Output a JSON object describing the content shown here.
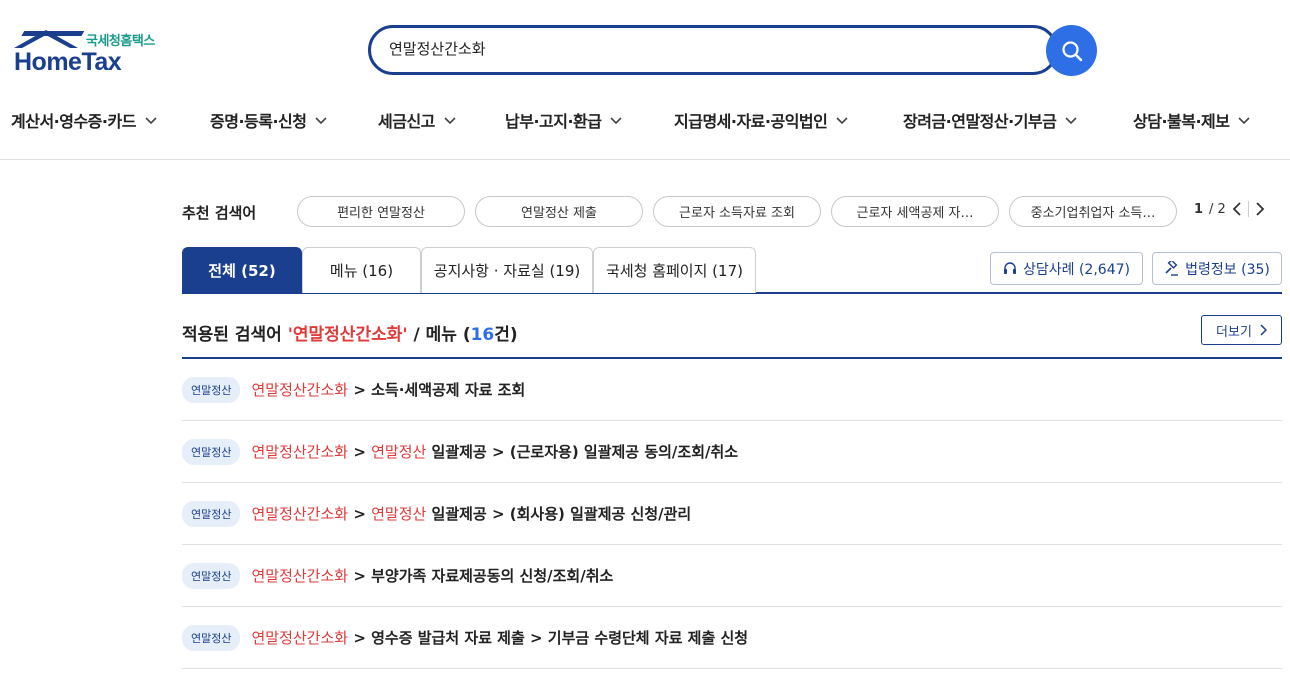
{
  "logo": {
    "small": "국세청홈택스",
    "big": "HomeTax"
  },
  "search": {
    "value": "연말정산간소화"
  },
  "nav": [
    "계산서·영수증·카드",
    "증명·등록·신청",
    "세금신고",
    "납부·고지·환급",
    "지급명세·자료·공익법인",
    "장려금·연말정산·기부금",
    "상담·불복·제보"
  ],
  "recommend": {
    "label": "추천 검색어",
    "chips": [
      "편리한 연말정산",
      "연말정산 제출",
      "근로자 소득자료 조회",
      "근로자 세액공제 자…",
      "중소기업취업자 소득…"
    ],
    "page_current": "1",
    "page_total": "/ 2"
  },
  "tabs": [
    "전체 (52)",
    "메뉴 (16)",
    "공지사항 · 자료실 (19)",
    "국세청 홈페이지 (17)"
  ],
  "side_buttons": {
    "consult": "상담사례 (2,647)",
    "law": "법령정보 (35)"
  },
  "result_head": {
    "prefix": "적용된 검색어 ",
    "keyword": "'연말정산간소화'",
    "middle": " / 메뉴 (",
    "count": "16",
    "suffix": "건)",
    "more": "더보기"
  },
  "results": [
    {
      "badge": "연말정산",
      "kw": "연말정산간소화",
      "kw2": "",
      "kw2_rest": "",
      "rest": " > 소득·세액공제 자료 조회"
    },
    {
      "badge": "연말정산",
      "kw": "연말정산간소화",
      "kw2": "연말정산",
      "kw2_rest": " 일괄제공",
      "rest": " > (근로자용) 일괄제공 동의/조회/취소"
    },
    {
      "badge": "연말정산",
      "kw": "연말정산간소화",
      "kw2": "연말정산",
      "kw2_rest": " 일괄제공",
      "rest": " > (회사용) 일괄제공 신청/관리"
    },
    {
      "badge": "연말정산",
      "kw": "연말정산간소화",
      "kw2": "",
      "kw2_rest": "",
      "rest": " > 부양가족 자료제공동의 신청/조회/취소"
    },
    {
      "badge": "연말정산",
      "kw": "연말정산간소화",
      "kw2": "",
      "kw2_rest": "",
      "rest": " > 영수증 발급처 자료 제출 > 기부금 수령단체 자료 제출 신청"
    }
  ]
}
